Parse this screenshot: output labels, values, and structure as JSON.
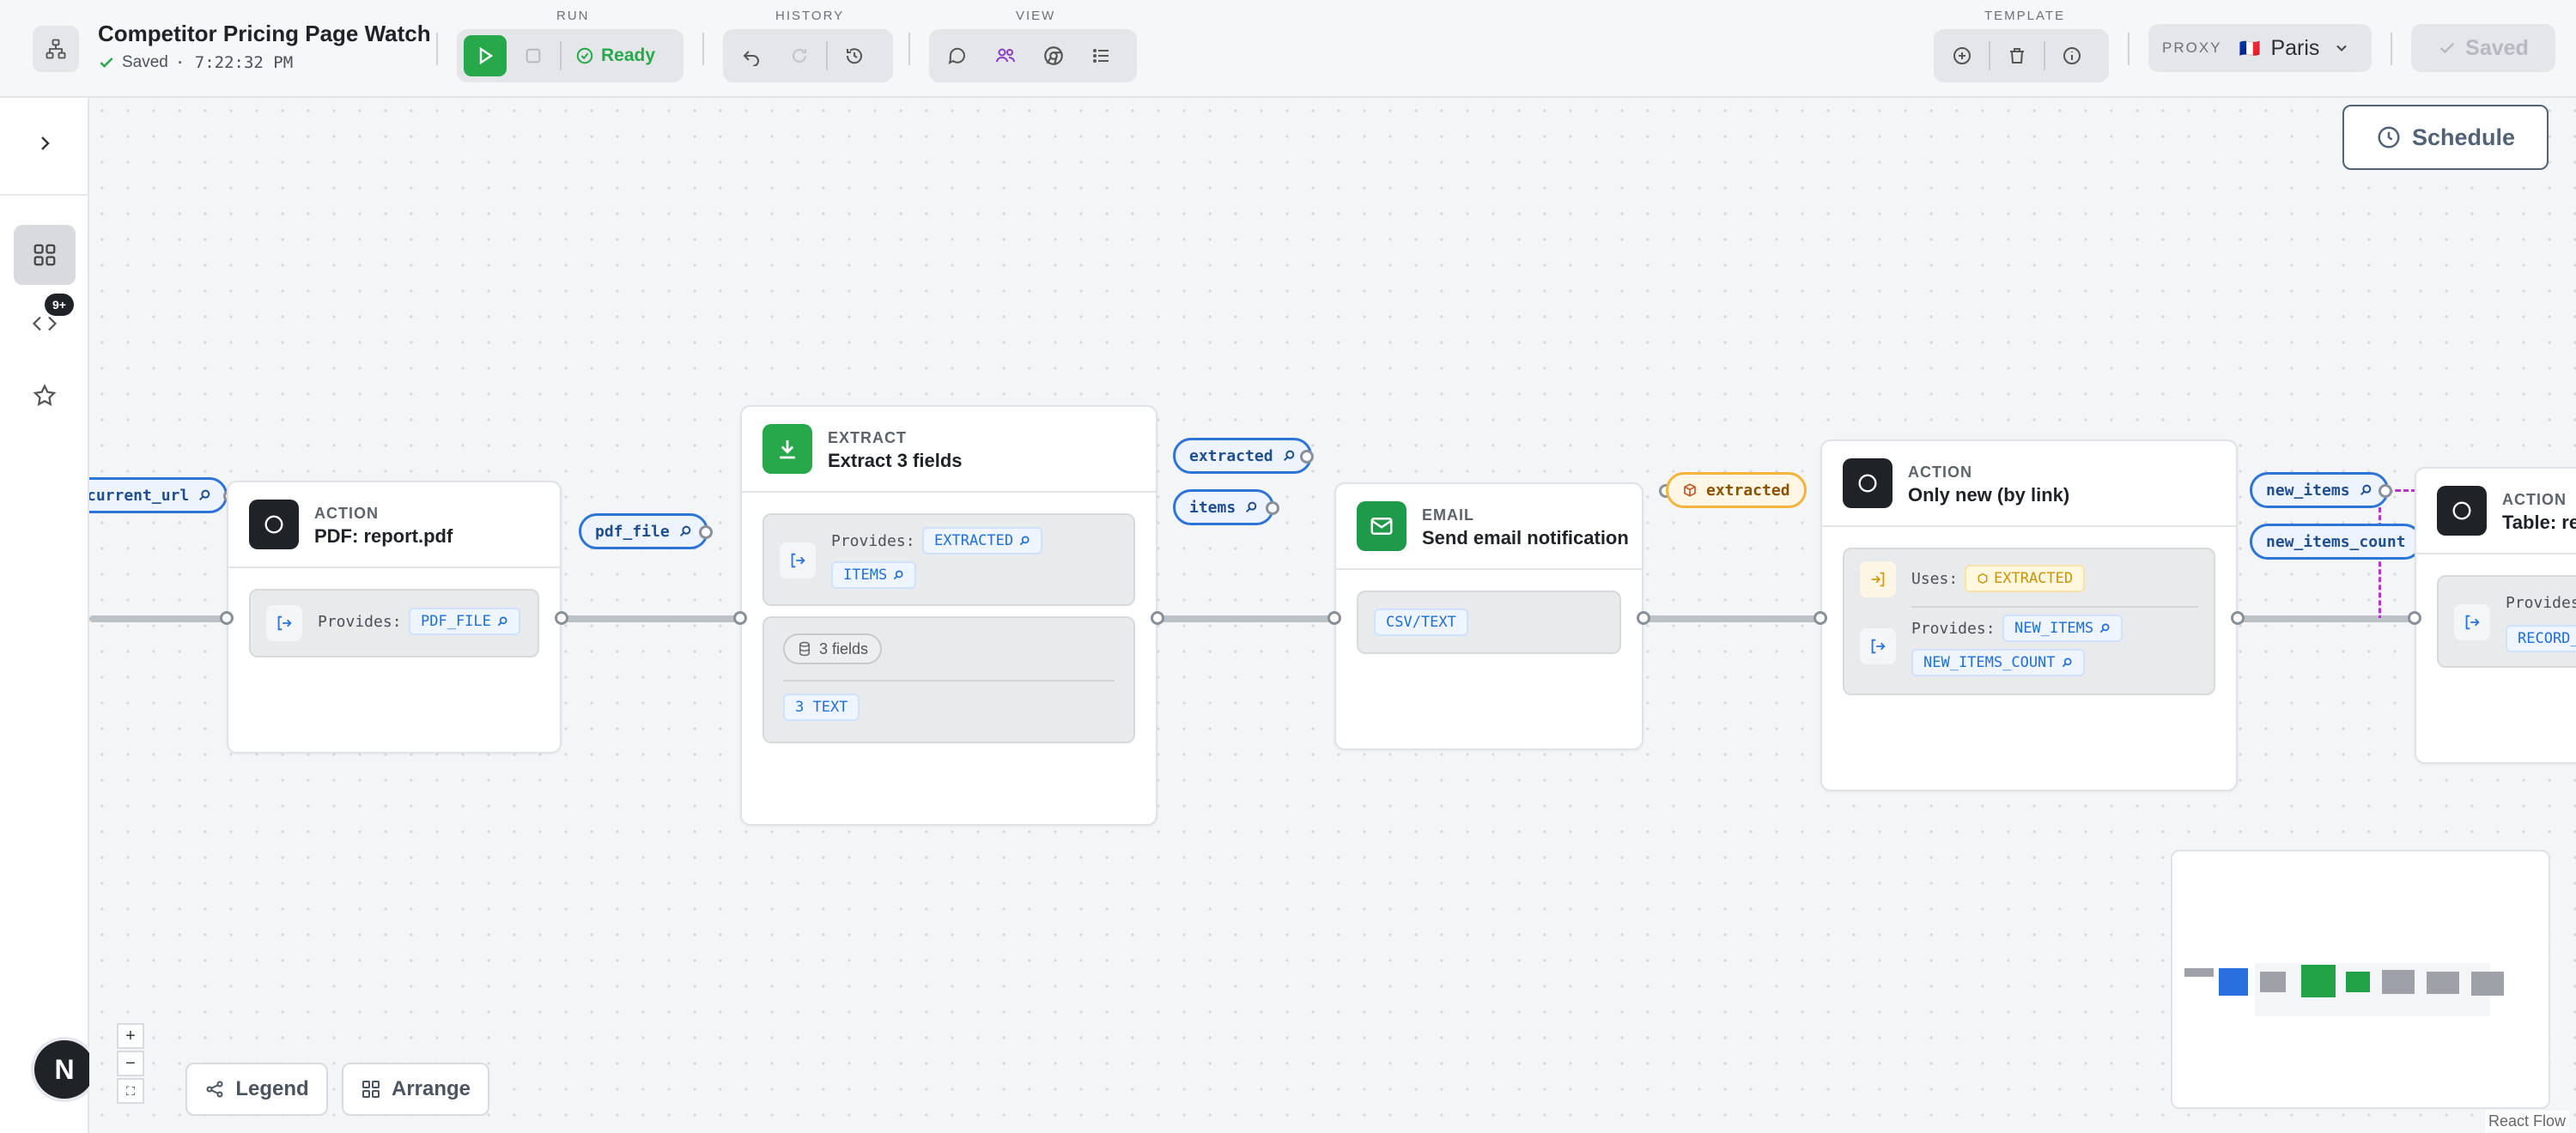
{
  "header": {
    "title": "Competitor Pricing Page Watch",
    "save_state": "Saved",
    "save_time": "· 7:22:32 PM"
  },
  "toolbar": {
    "run_label": "RUN",
    "ready_label": "Ready",
    "history_label": "HISTORY",
    "view_label": "VIEW",
    "template_label": "TEMPLATE",
    "proxy_label": "PROXY",
    "proxy_flag": "🇫🇷",
    "proxy_location": "Paris",
    "saved_button": "Saved"
  },
  "canvas": {
    "schedule_button": "Schedule",
    "legend_button": "Legend",
    "arrange_button": "Arrange",
    "react_flow_label": "React Flow",
    "zoom_in": "+",
    "zoom_out": "−",
    "fit_view": "⛶",
    "avatar_letter": "N",
    "rail_badge": "9+"
  },
  "pills": {
    "current_url": "current_url",
    "pdf_file": "pdf_file",
    "extracted": "extracted",
    "items": "items",
    "extracted_orange": "extracted",
    "new_items": "new_items",
    "new_items_count": "new_items_count"
  },
  "nodes": {
    "pdf": {
      "type": "ACTION",
      "title": "PDF: report.pdf",
      "provides_label": "Provides:",
      "provides_chip": "PDF_FILE"
    },
    "extract": {
      "type": "EXTRACT",
      "title": "Extract 3 fields",
      "provides_label": "Provides:",
      "chip1": "EXTRACTED",
      "chip2": "ITEMS",
      "fields_badge": "3 fields",
      "text_chip": "3 TEXT"
    },
    "email": {
      "type": "EMAIL",
      "title": "Send email notification",
      "chip": "CSV/TEXT"
    },
    "only_new": {
      "type": "ACTION",
      "title": "Only new (by link)",
      "uses_label": "Uses:",
      "uses_chip": "EXTRACTED",
      "provides_label": "Provides:",
      "chip1": "NEW_ITEMS",
      "chip2": "NEW_ITEMS_COUNT"
    },
    "table": {
      "type": "ACTION",
      "title": "Table: re",
      "provides_label": "Provides",
      "chip": "RECORD_"
    }
  },
  "colors": {
    "accent_green": "#27a84a",
    "accent_blue": "#2c74d6",
    "accent_orange": "#f4b33a",
    "email_green": "#1f9a4a",
    "dark_icon": "#1f2328"
  }
}
